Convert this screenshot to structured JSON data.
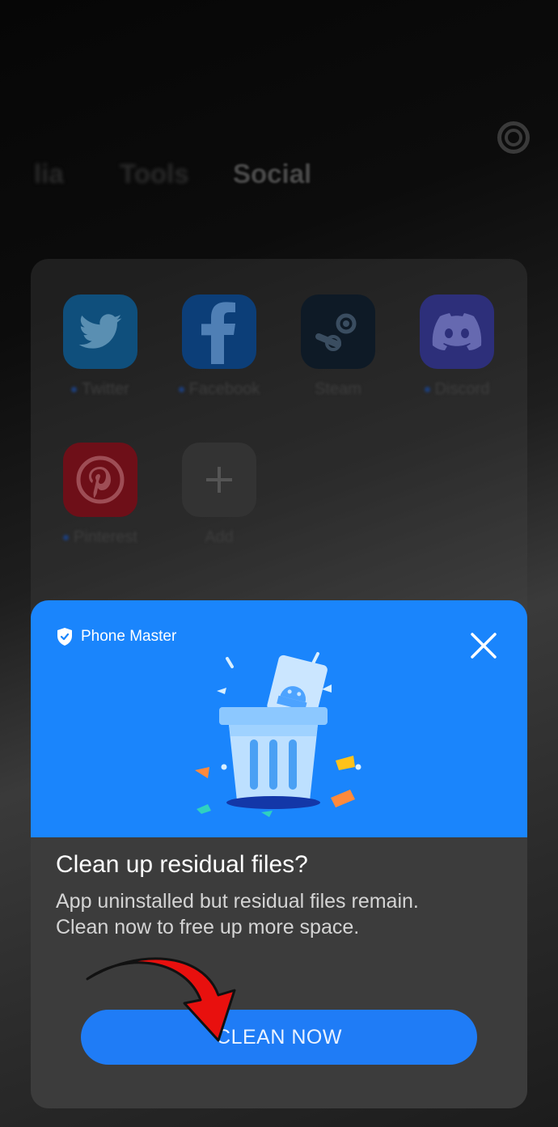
{
  "background": {
    "tabs": [
      "lia",
      "Tools",
      "Social"
    ],
    "apps": [
      {
        "label": "Twitter",
        "icon": "twitter-icon",
        "color": "#1d9bf0",
        "dot": true
      },
      {
        "label": "Facebook",
        "icon": "facebook-icon",
        "color": "#1877f2",
        "dot": true
      },
      {
        "label": "Steam",
        "icon": "steam-icon",
        "color": "#1b2838",
        "dot": false
      },
      {
        "label": "Discord",
        "icon": "discord-icon",
        "color": "#5865f2",
        "dot": true
      },
      {
        "label": "Pinterest",
        "icon": "pinterest-icon",
        "color": "#e60023",
        "dot": true
      },
      {
        "label": "Add",
        "icon": "plus-icon",
        "color": "#3a3a3a",
        "dot": false
      }
    ]
  },
  "dialog": {
    "brand": "Phone Master",
    "title": "Clean up residual files?",
    "body_line1": "App uninstalled but residual files remain.",
    "body_line2": "Clean now to free up more space.",
    "button": "CLEAN NOW",
    "accent": "#1a85fc"
  }
}
